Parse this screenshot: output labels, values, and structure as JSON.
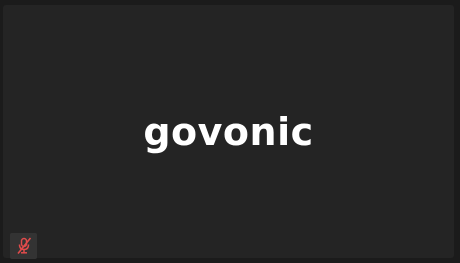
{
  "participant": {
    "display_name": "govonic",
    "mic_icon": "mic-muted-icon",
    "muted_color": "#e04b4b"
  },
  "colors": {
    "page_background": "#1b1b1b",
    "tile_background": "#242424",
    "badge_background": "#333333",
    "name_text": "#ffffff"
  }
}
